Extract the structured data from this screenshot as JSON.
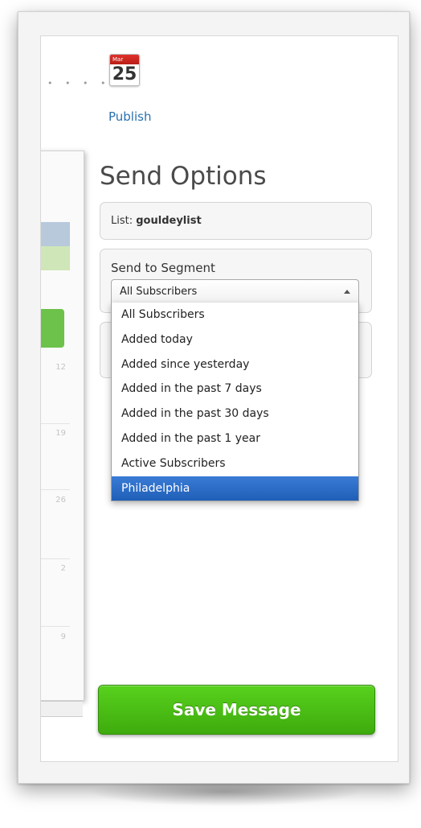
{
  "publish": {
    "calendar_month": "Mar",
    "calendar_day": "25",
    "label": "Publish"
  },
  "background_calendar": {
    "day_numbers": [
      "12",
      "19",
      "26",
      "2",
      "9"
    ]
  },
  "send_options": {
    "title": "Send Options",
    "list_prefix": "List:",
    "list_name": "gouldeylist",
    "segment_label": "Send to Segment",
    "segment_selected": "All Subscribers",
    "segment_options": [
      "All Subscribers",
      "Added today",
      "Added since yesterday",
      "Added in the past 7 days",
      "Added in the past 30 days",
      "Added in the past 1 year",
      "Active Subscribers",
      "Philadelphia"
    ],
    "highlighted_option": "Philadelphia"
  },
  "actions": {
    "save_label": "Save Message"
  },
  "colors": {
    "link": "#2a71b0",
    "save_button": "#4bbf14",
    "highlight": "#2a6ccb"
  }
}
